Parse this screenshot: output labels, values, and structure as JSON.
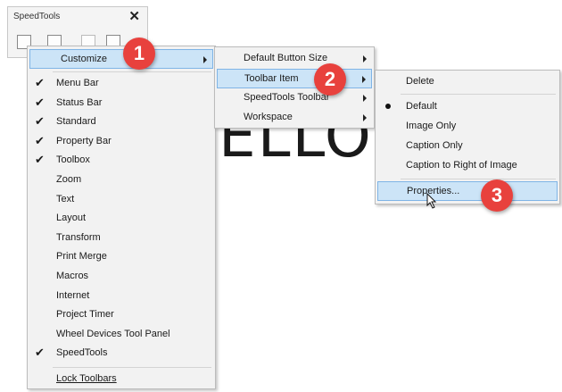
{
  "toolbar": {
    "title": "SpeedTools",
    "close_glyph": "✕"
  },
  "canvas": {
    "text": "ELLO W"
  },
  "menu1": {
    "customize": "Customize",
    "items": [
      {
        "label": "Menu Bar",
        "checked": true
      },
      {
        "label": "Status Bar",
        "checked": true
      },
      {
        "label": "Standard",
        "checked": true
      },
      {
        "label": "Property Bar",
        "checked": true
      },
      {
        "label": "Toolbox",
        "checked": true
      },
      {
        "label": "Zoom",
        "checked": false
      },
      {
        "label": "Text",
        "checked": false
      },
      {
        "label": "Layout",
        "checked": false
      },
      {
        "label": "Transform",
        "checked": false
      },
      {
        "label": "Print Merge",
        "checked": false
      },
      {
        "label": "Macros",
        "checked": false
      },
      {
        "label": "Internet",
        "checked": false
      },
      {
        "label": "Project Timer",
        "checked": false
      },
      {
        "label": "Wheel Devices Tool Panel",
        "checked": false
      },
      {
        "label": "SpeedTools",
        "checked": true
      }
    ],
    "lock_toolbars": "Lock Toolbars"
  },
  "menu2": {
    "default_button_size": "Default Button Size",
    "toolbar_item": "Toolbar Item",
    "speedtools_toolbar": "SpeedTools Toolbar",
    "workspace": "Workspace"
  },
  "menu3": {
    "delete": "Delete",
    "default": "Default",
    "image_only": "Image Only",
    "caption_only": "Caption Only",
    "caption_right": "Caption to Right of Image",
    "properties": "Properties..."
  },
  "badges": {
    "one": "1",
    "two": "2",
    "three": "3"
  },
  "colors": {
    "highlight": "#cce4f7",
    "highlight_border": "#7fb4e6",
    "badge": "#e8413d"
  },
  "icons": [
    "close-icon",
    "toolbar-icon",
    "check-icon",
    "radio-dot-icon",
    "submenu-arrow-icon",
    "mouse-cursor-icon"
  ]
}
